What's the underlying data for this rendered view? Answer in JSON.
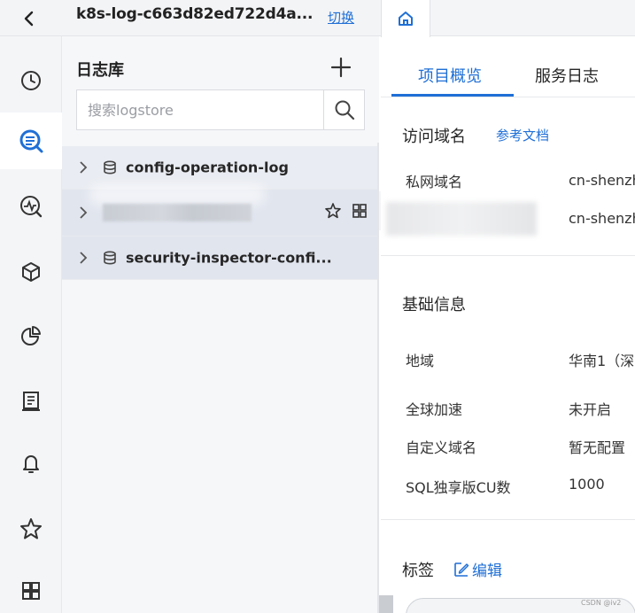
{
  "header": {
    "project_name": "k8s-log-c663d82ed722d4a...",
    "switch_label": "切换"
  },
  "panel": {
    "title": "日志库",
    "search_placeholder": "搜索logstore",
    "items": [
      {
        "name": "config-operation-log"
      },
      {
        "name": ""
      },
      {
        "name": "security-inspector-confi..."
      }
    ]
  },
  "tabs": [
    {
      "label": "项目概览",
      "active": true
    },
    {
      "label": "服务日志",
      "active": false
    }
  ],
  "access": {
    "title": "访问域名",
    "doc_link": "参考文档",
    "rows": [
      {
        "label": "私网域名",
        "value": "cn-shenzh"
      },
      {
        "label": "",
        "value": "cn-shenzh"
      }
    ]
  },
  "basic": {
    "title": "基础信息",
    "rows": [
      {
        "label": "地域",
        "value": "华南1（深"
      },
      {
        "label": "全球加速",
        "value": "未开启"
      },
      {
        "label": "自定义域名",
        "value": "暂无配置"
      },
      {
        "label": "SQL独享版CU数",
        "value": "1000"
      }
    ]
  },
  "tags": {
    "title": "标签",
    "edit_label": "编辑"
  },
  "watermark": "CSDN @iv2",
  "colors": {
    "accent": "#1f6fd6",
    "rail_bg": "#f4f5f7",
    "panel_bg": "#f6f7f9",
    "row_selected": "#e1e5ee"
  },
  "icons": {
    "rail": [
      "clock-icon",
      "log-search-icon",
      "monitor-icon",
      "cube-icon",
      "pie-chart-icon",
      "report-icon",
      "bell-icon",
      "star-icon",
      "grid-icon"
    ]
  }
}
